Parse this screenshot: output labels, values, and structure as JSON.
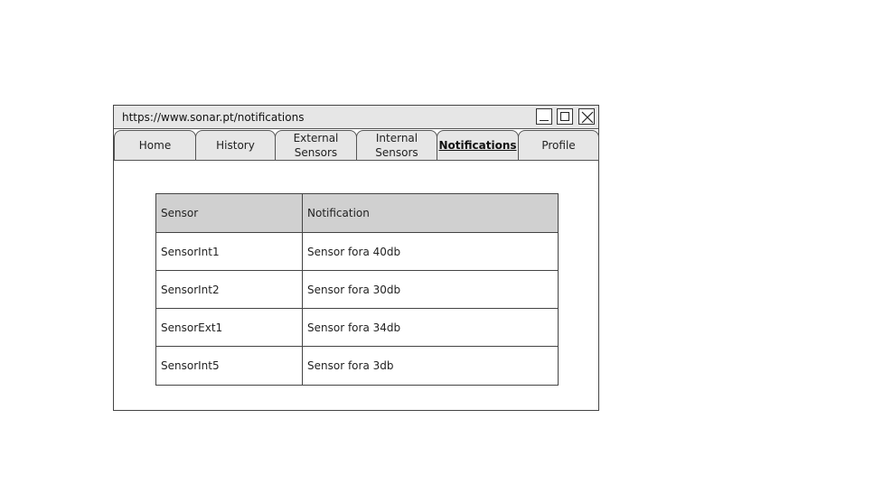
{
  "window": {
    "url": "https://www.sonar.pt/notifications"
  },
  "tabs": [
    {
      "label": "Home",
      "active": false
    },
    {
      "label": "History",
      "active": false
    },
    {
      "label": "External\nSensors",
      "active": false
    },
    {
      "label": "Internal\nSensors",
      "active": false
    },
    {
      "label": "Notifications",
      "active": true
    },
    {
      "label": "Profile",
      "active": false
    }
  ],
  "table": {
    "columns": [
      "Sensor",
      "Notification"
    ],
    "rows": [
      [
        "SensorInt1",
        "Sensor fora 40db"
      ],
      [
        "SensorInt2",
        "Sensor fora 30db"
      ],
      [
        "SensorExt1",
        "Sensor fora 34db"
      ],
      [
        "SensorInt5",
        "Sensor fora 3db"
      ]
    ]
  },
  "icons": {
    "minimize": "minimize-icon",
    "maximize": "maximize-icon",
    "close": "close-icon"
  }
}
